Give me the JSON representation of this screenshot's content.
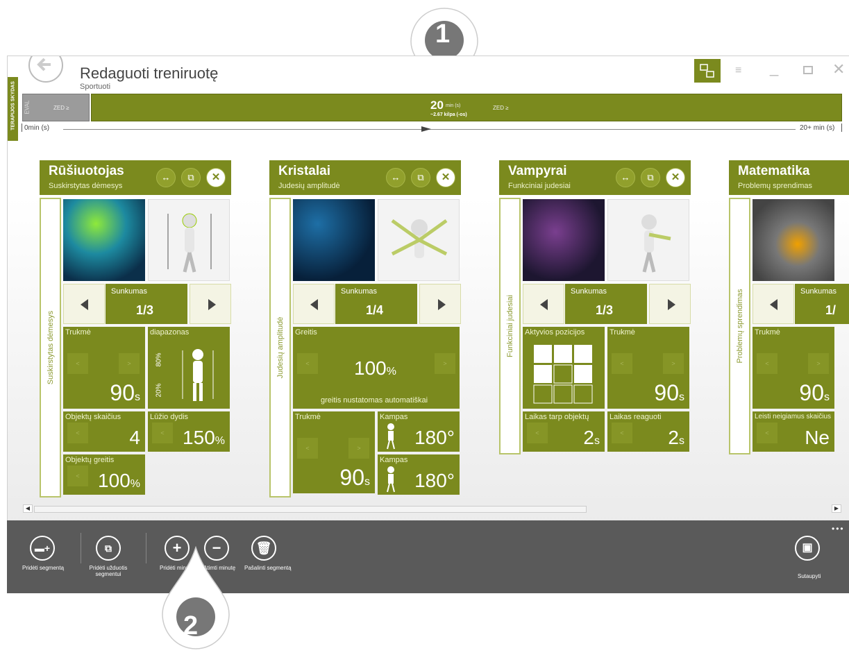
{
  "header": {
    "title": "Redaguoti treniruotę",
    "subtitle": "Sportuoti",
    "therapy_label": "TERAPIJOS SKYDAS"
  },
  "timeline": {
    "eval_label": "EVAL",
    "seg1_label": "ZED ≥",
    "main_value": "20",
    "main_unit": "min (s)",
    "main_sub": "~2.67 kilpa (-os)",
    "main_label": "ZED ≥",
    "start": "0min (s)",
    "end": "20+ min (s)"
  },
  "callouts": {
    "one": "1",
    "two": "2"
  },
  "cards": [
    {
      "title": "Rūšiuotojas",
      "subtitle": "Suskirstytas dėmesys",
      "side": "Suskirstytas dėmesys",
      "difficulty_label": "Sunkumas",
      "difficulty": "1/3",
      "t1_label": "Trukmė",
      "t1_value": "90",
      "t1_unit": "s",
      "t2_label": "diapazonas",
      "t2_a": "80%",
      "t2_b": "20%",
      "t3_label": "Objektų skaičius",
      "t3_value": "4",
      "t4_label": "Lūžio dydis",
      "t4_value": "150",
      "t4_unit": "%",
      "t5_label": "Objektų greitis",
      "t5_value": "100",
      "t5_unit": "%"
    },
    {
      "title": "Kristalai",
      "subtitle": "Judesių amplitudė",
      "side": "Judesių amplitudė",
      "difficulty_label": "Sunkumas",
      "difficulty": "1/4",
      "t1_label": "Greitis",
      "t1_value": "100",
      "t1_unit": "%",
      "t1_note": "greitis nustatomas automatiškai",
      "t2_label": "Trukmė",
      "t2_value": "90",
      "t2_unit": "s",
      "t3_label": "Kampas",
      "t3_value": "180°",
      "t4_label": "Kampas",
      "t4_value": "180°"
    },
    {
      "title": "Vampyrai",
      "subtitle": "Funkciniai judesiai",
      "side": "Funkciniai judesiai",
      "difficulty_label": "Sunkumas",
      "difficulty": "1/3",
      "t1_label": "Aktyvios pozicijos",
      "t2_label": "Trukmė",
      "t2_value": "90",
      "t2_unit": "s",
      "t3_label": "Laikas tarp objektų",
      "t3_value": "2",
      "t3_unit": "s",
      "t4_label": "Laikas reaguoti",
      "t4_value": "2",
      "t4_unit": "s"
    },
    {
      "title": "Matematika",
      "subtitle": "Problemų sprendimas",
      "side": "Problemų sprendimas",
      "difficulty_label": "Sunkumas",
      "difficulty": "1/",
      "t1_label": "Trukmė",
      "t1_value": "90",
      "t1_unit": "s",
      "t2_label": "Leisti neigiamus skaičius",
      "t2_value": "Ne"
    }
  ],
  "toolbar": {
    "add_segment": "Pridėti segmentą",
    "add_tasks": "Pridėti užduotis segmentui",
    "add_minute": "Pridėti minutę",
    "remove_minute": "Atimti minutę",
    "delete_segment": "Pašalinti segmentą",
    "save": "Sutaupyti"
  },
  "colors": {
    "accent": "#7b8a1e",
    "toolbar": "#5a5a5a"
  }
}
